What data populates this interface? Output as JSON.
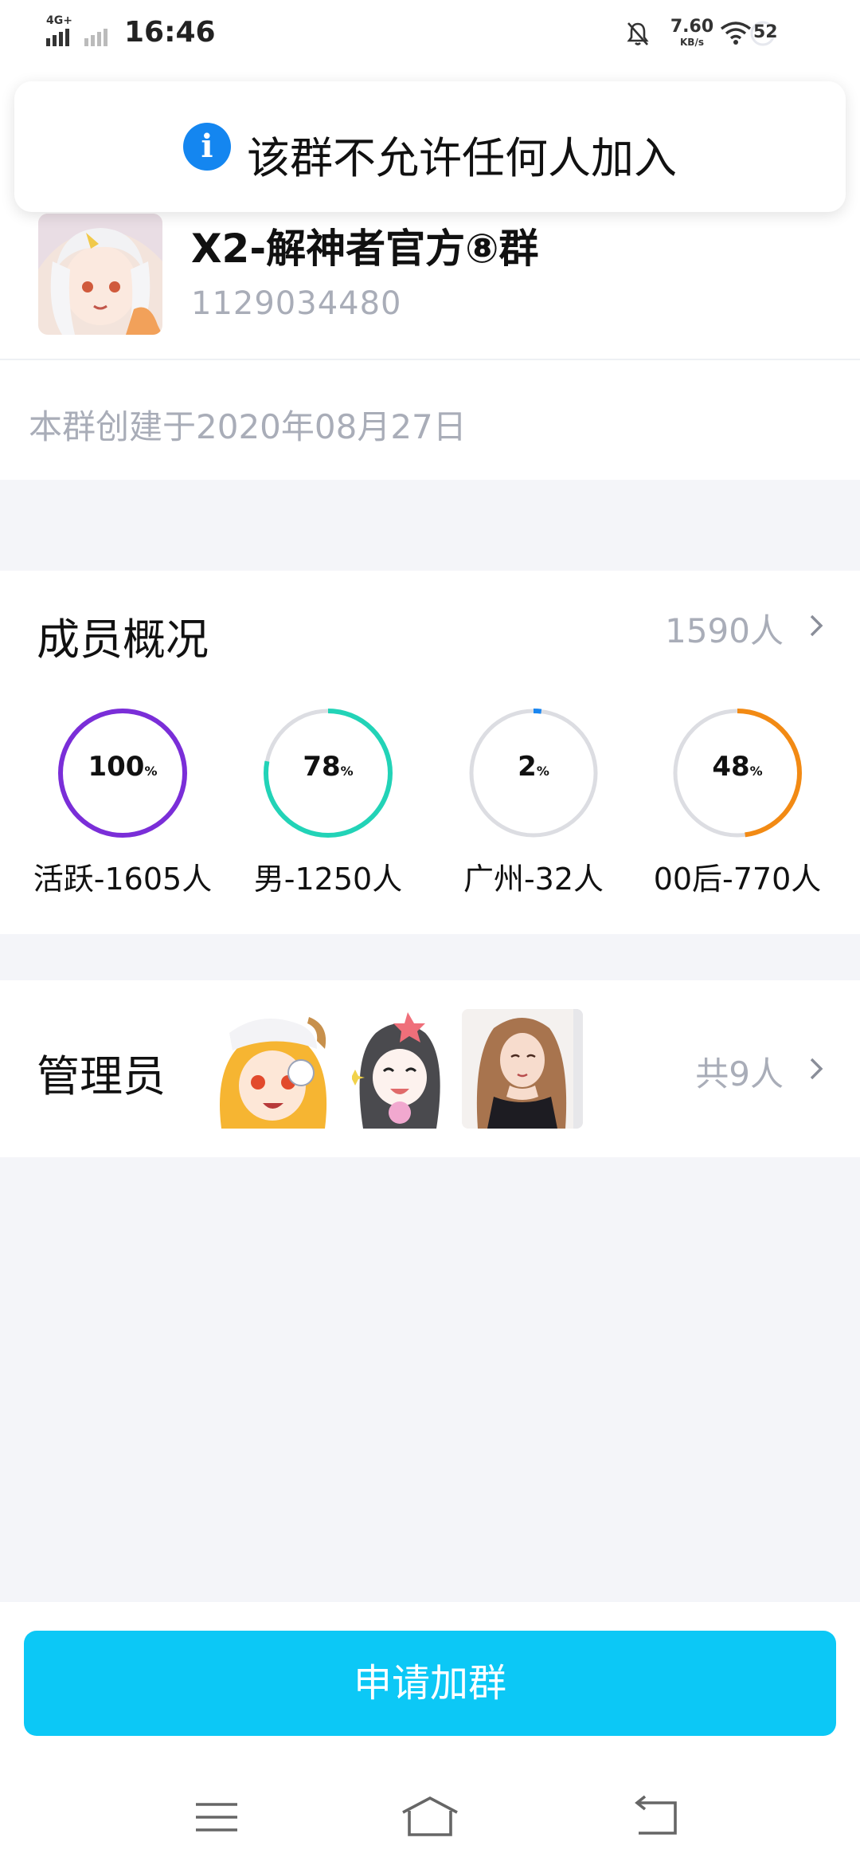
{
  "status_bar": {
    "network": "4G+",
    "time": "16:46",
    "speed_value": "7.60",
    "speed_unit": "KB/s",
    "battery": "52"
  },
  "toast": {
    "icon": "info-icon",
    "message": "该群不允许任何人加入"
  },
  "group": {
    "name": "X2-解神者官方⑧群",
    "id": "1129034480",
    "created": "本群创建于2020年08月27日"
  },
  "members": {
    "title": "成员概况",
    "count": "1590人",
    "stats": [
      {
        "percent": 100,
        "label": "活跃-1605人",
        "color": "#7a2ed8"
      },
      {
        "percent": 78,
        "label": "男-1250人",
        "color": "#22d3b7"
      },
      {
        "percent": 2,
        "label": "广州-32人",
        "color": "#1a86f0"
      },
      {
        "percent": 48,
        "label": "00后-770人",
        "color": "#f28a14"
      }
    ]
  },
  "admins": {
    "title": "管理员",
    "count": "共9人"
  },
  "actions": {
    "apply_label": "申请加群"
  },
  "nav": {
    "menu_icon": "menu-icon",
    "home_icon": "home-icon",
    "back_icon": "back-icon"
  },
  "colors": {
    "accent": "#0cc8f6",
    "info": "#1486f0",
    "muted_text": "#a9adb8",
    "page_bg": "#f4f5f9"
  }
}
